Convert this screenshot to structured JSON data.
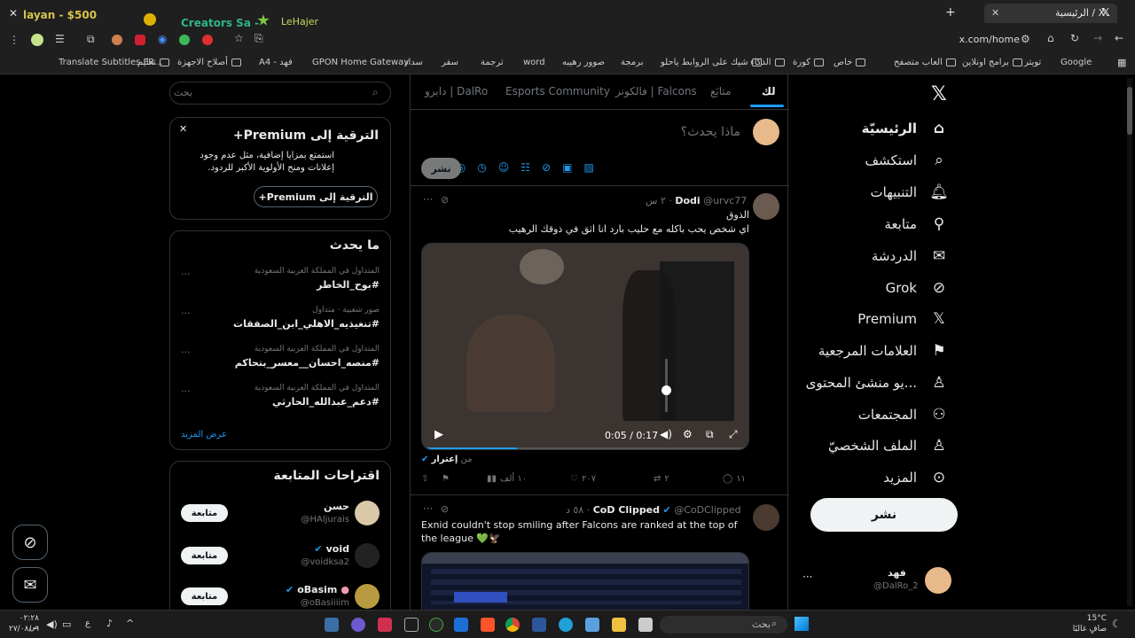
{
  "browser": {
    "tab_title": "الرئيسية / X",
    "other_tabs": [
      "layan - $500",
      "Creators Sa -",
      "LeHajer"
    ],
    "url": "x.com/home",
    "bookmarks": [
      "Google",
      "تويتر",
      "برامج اونلاين",
      "العاب متصفح",
      "خاص",
      "كورة",
      "الذكاء",
      "شيك على الروابط ياحلو",
      "برمجة",
      "صوور رهيبه",
      "word",
      "ترجمة",
      "سفر",
      "سداد",
      "GPON Home Gateway",
      "فهد - A4",
      "أصلاح الاجهزة",
      "تعليم",
      "Translate Subtitles FR..."
    ]
  },
  "nav": {
    "items": [
      {
        "label": "الرئيسيّة",
        "icon": "home-icon"
      },
      {
        "label": "استكشف",
        "icon": "search-icon"
      },
      {
        "label": "التنبيهات",
        "icon": "bell-icon"
      },
      {
        "label": "متابعة",
        "icon": "follow-icon"
      },
      {
        "label": "الدردشة",
        "icon": "mail-icon"
      },
      {
        "label": "Grok",
        "icon": "grok-icon"
      },
      {
        "label": "Premium",
        "icon": "x-icon"
      },
      {
        "label": "العلامات المرجعية",
        "icon": "bookmark-icon"
      },
      {
        "label": "...يو منشئ المحتوى",
        "icon": "creator-icon"
      },
      {
        "label": "المجتمعات",
        "icon": "communities-icon"
      },
      {
        "label": "الملف الشخصيّ",
        "icon": "profile-icon"
      },
      {
        "label": "المزيد",
        "icon": "more-icon"
      }
    ],
    "post_button": "نشر",
    "account_name": "فهد",
    "account_handle": "@DalRo_2"
  },
  "feed": {
    "tabs": [
      "لك",
      "متابَع",
      "فالكونز | Falcons",
      "Esports Community",
      "دابرو | DalRo"
    ],
    "compose_placeholder": "ماذا يحدث؟",
    "compose_post": "نشر",
    "tweet1": {
      "name": "Dodi",
      "handle": "@urvc77",
      "time": "٢ س",
      "line1": "الذوق",
      "line2": "اي شخص يحب باكله مع حليب بارد انا اثق في ذوقك الرهيب",
      "video_time": "0:05 / 0:17",
      "source_label": "إعترار",
      "source_suffix": "من",
      "replies": "١١",
      "retweets": "٢",
      "likes": "٢٠٧",
      "views": "١٠ ألف",
      "video_progress": 0.29
    },
    "tweet2": {
      "name": "CoD Clipped",
      "handle": "@CoDClipped",
      "time": "٥٨ د",
      "text": "Exnid couldn't stop smiling after Falcons are ranked at the top of the league 💚🦅"
    }
  },
  "sidebar": {
    "search_placeholder": "بحث",
    "premium": {
      "title": "الترقية إلى Premium+",
      "body": "استمتع بمزايا إضافية، مثل عدم وجود إعلانات ومنح الأولوية الأكبر للردود.",
      "button": "الترقية إلى Premium+"
    },
    "trends_title": "ما يحدث",
    "trends": [
      {
        "meta": "المتداول في المملكة العربية السعودية",
        "name": "#بوح_الخاطر"
      },
      {
        "meta": "صور شعبية · متداول",
        "name": "#تنغيذيه_الاهلي_ابن_الصفقات"
      },
      {
        "meta": "المتداول في المملكة العربية السعودية",
        "name": "#منصه_احسان__معسر_بتحاكم"
      },
      {
        "meta": "المتداول في المملكة العربية السعودية",
        "name": "#دعم_عبدالله_الحارثي"
      }
    ],
    "show_more": "عرض المزيد",
    "who_to_follow_title": "اقتراحات المتابعة",
    "suggestions": [
      {
        "name": "حسن",
        "handle": "@HAljurais"
      },
      {
        "name": "void",
        "handle": "@voidksa2"
      },
      {
        "name": "oBasim",
        "handle": "@oBasiiiim"
      }
    ],
    "follow_label": "متابعة"
  },
  "taskbar": {
    "search_placeholder": "بحث",
    "weather_temp": "15°C",
    "weather_desc": "صافٍ غالبًا",
    "time": "٠٢:٢٨ ص",
    "date": "٢٧/٠٨/٠١",
    "lang": "ع"
  }
}
